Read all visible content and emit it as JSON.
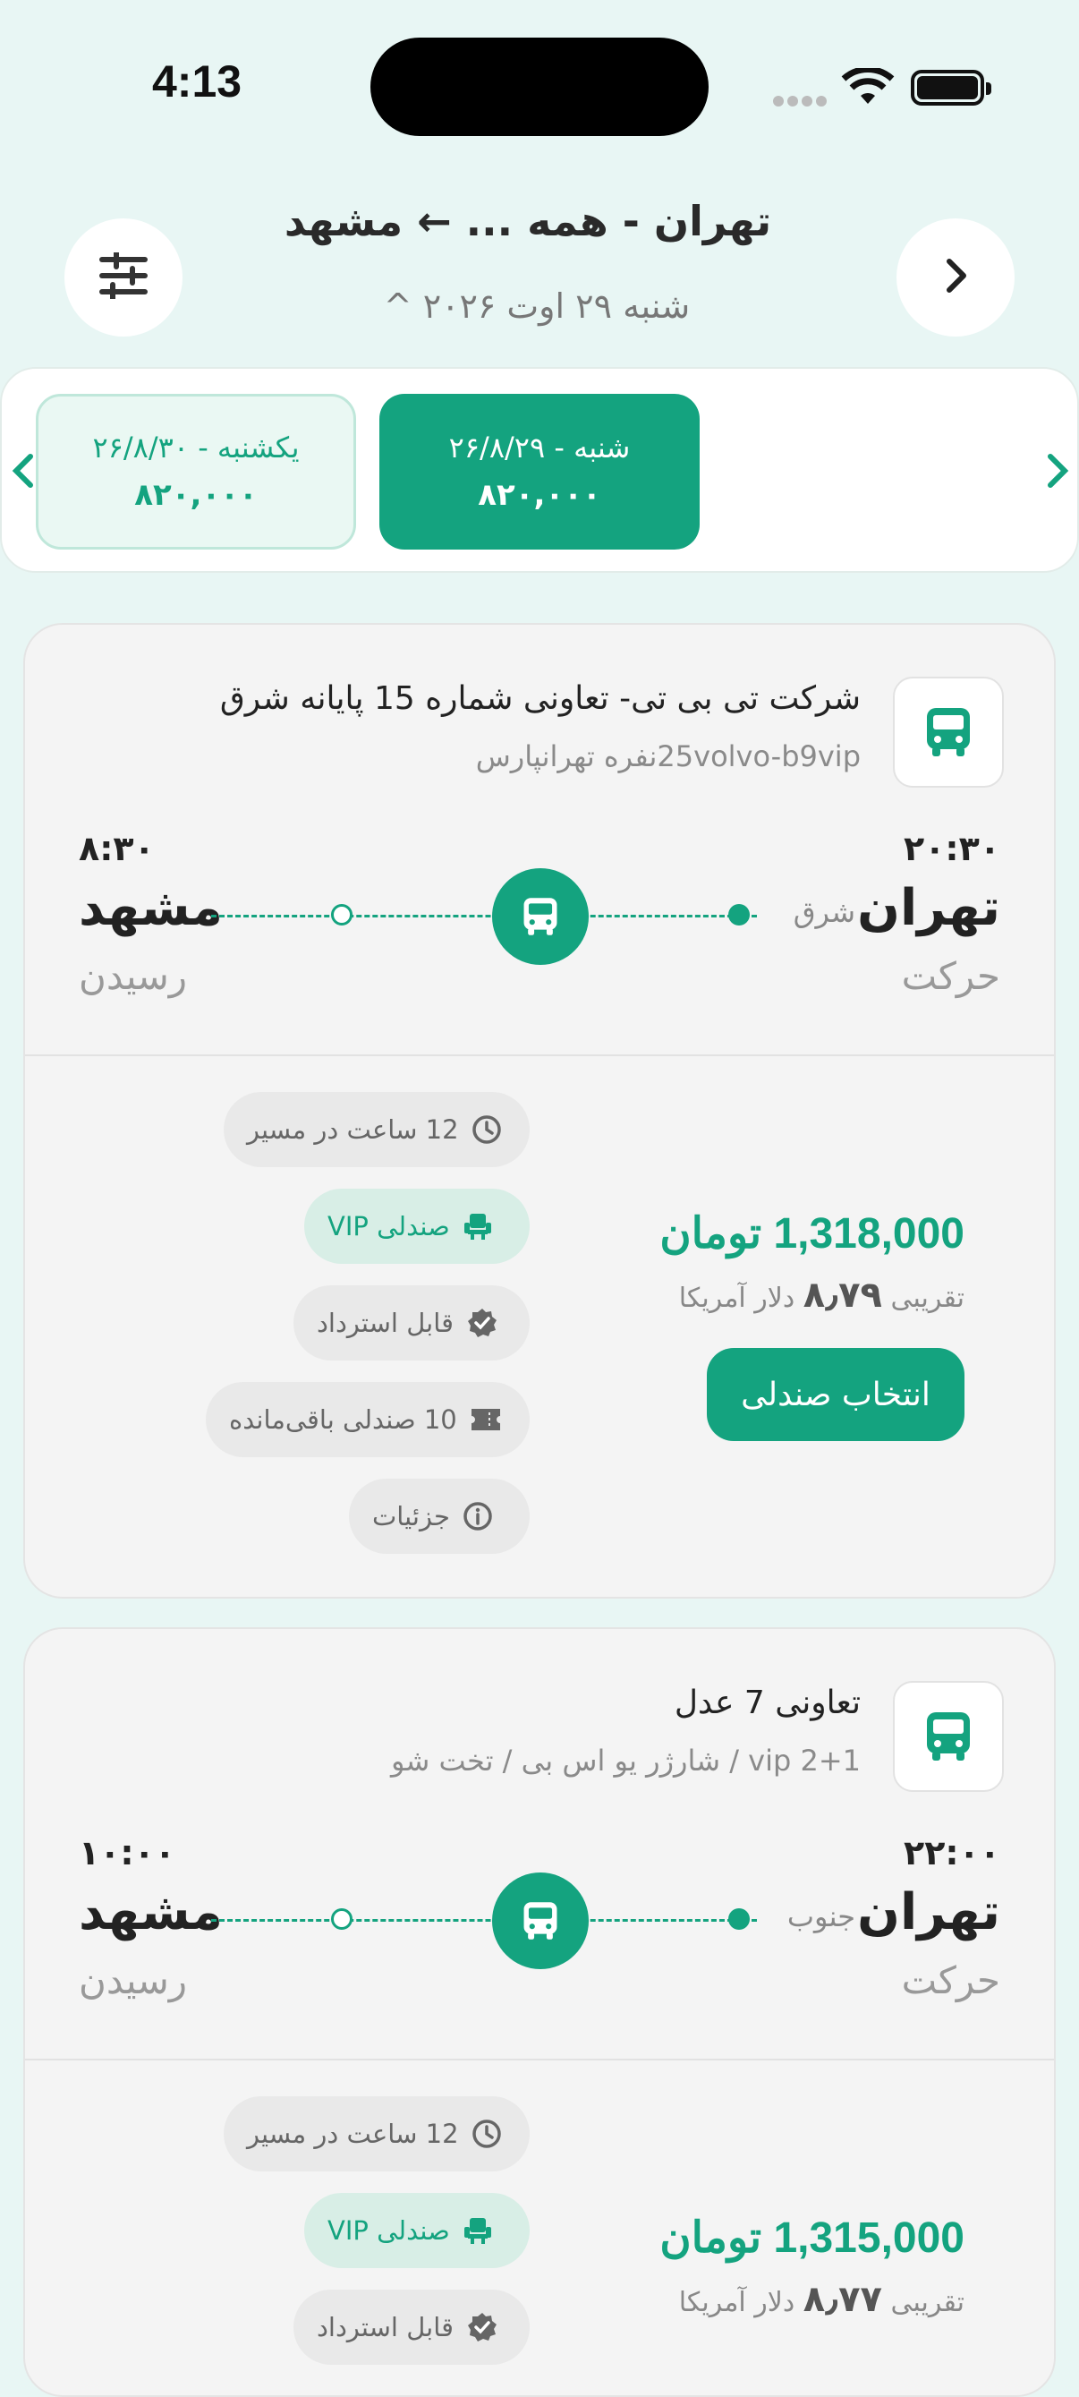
{
  "status_bar": {
    "time": "4:13"
  },
  "header": {
    "route_title": "تهران - همه ... ← مشهد",
    "date": "شنبه ۲۹ اوت ۲۰۲۶ ^"
  },
  "date_strip": [
    {
      "date": "شنبه - ۲۶/۸/۲۹",
      "price": "۸۲۰,۰۰۰",
      "active": true
    },
    {
      "date": "یکشنبه - ۲۶/۸/۳۰",
      "price": "۸۲۰,۰۰۰",
      "active": false
    }
  ],
  "trips": [
    {
      "company": "شرکت تی بی تی- تعاونی شماره 15 پایانه شرق",
      "bus_type": "25volvo-b9vipنفره تهرانپارس",
      "departure_time": "۲۰:۳۰",
      "origin": "تهران",
      "origin_terminal": "شرق",
      "departure_label": "حرکت",
      "arrival_time": "۸:۳۰",
      "destination": "مشهد",
      "arrival_label": "رسیدن",
      "chips": {
        "duration": "12 ساعت در مسیر",
        "seat_type": "صندلی VIP",
        "refund": "قابل استرداد",
        "remaining": "10 صندلی باقی‌مانده",
        "details": "جزئیات"
      },
      "price": "1,318,000 تومان",
      "approx_prefix": "تقریبی",
      "approx_value": "۸٫۷۹",
      "approx_suffix": "دلار آمریکا",
      "select_label": "انتخاب صندلی"
    },
    {
      "company": "تعاونی 7 عدل",
      "bus_type": "vip 2+1 / شارژر یو اس بی / تخت شو",
      "departure_time": "۲۲:۰۰",
      "origin": "تهران",
      "origin_terminal": "جنوب",
      "departure_label": "حرکت",
      "arrival_time": "۱۰:۰۰",
      "destination": "مشهد",
      "arrival_label": "رسیدن",
      "chips": {
        "duration": "12 ساعت در مسیر",
        "seat_type": "صندلی VIP",
        "refund": "قابل استرداد"
      },
      "price": "1,315,000 تومان",
      "approx_prefix": "تقریبی",
      "approx_value": "۸٫۷۷",
      "approx_suffix": "دلار آمریکا"
    }
  ],
  "colors": {
    "accent": "#14a37f",
    "background": "#e8f6f4"
  },
  "icons": [
    "filter-icon",
    "back-arrow-icon",
    "bus-icon",
    "clock-icon",
    "seat-icon",
    "verified-icon",
    "ticket-icon",
    "info-icon"
  ]
}
